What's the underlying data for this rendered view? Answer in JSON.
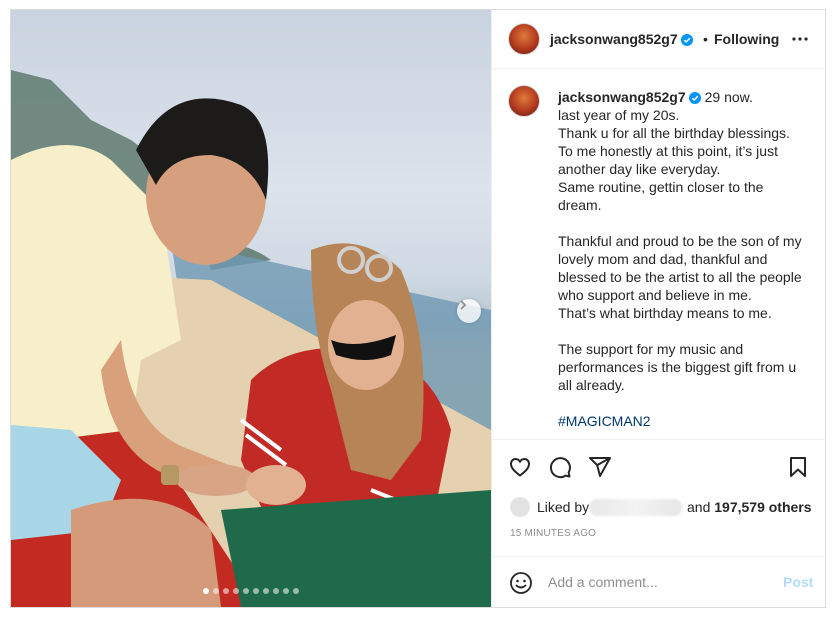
{
  "post": {
    "username": "jacksonwang852g7",
    "verified": true,
    "follow_separator": "•",
    "follow_status": "Following",
    "more_icon": "more-horizontal-icon"
  },
  "caption": {
    "username": "jacksonwang852g7",
    "first_line": "29 now.",
    "lines": [
      "last year of my 20s.",
      "Thank u for all the birthday blessings.",
      "To me honestly at this point, it’s just another day like everyday.",
      "Same routine, gettin closer to the dream.",
      "",
      "Thankful and proud to be the son of my lovely mom and dad, thankful and blessed to be the artist to all the people who support and believe in me.",
      "That’s what birthday means to me.",
      "",
      "The support for my music and performances is the biggest gift from u all already.",
      "",
      "#MAGICMAN2"
    ]
  },
  "carousel": {
    "total_slides": 10,
    "current_slide": 1
  },
  "actions": {
    "like_icon": "heart-icon",
    "comment_icon": "comment-icon",
    "share_icon": "send-icon",
    "save_icon": "bookmark-icon"
  },
  "likes": {
    "prefix": "Liked by",
    "suffix": "and",
    "count_text": "197,579 others"
  },
  "timestamp": "15 MINUTES AGO",
  "comment": {
    "placeholder": "Add a comment...",
    "post_label": "Post",
    "emoji_icon": "emoji-icon"
  },
  "colors": {
    "verified_blue": "#0095f6",
    "post_disabled": "#b3dbff",
    "hashtag": "#00376b"
  }
}
